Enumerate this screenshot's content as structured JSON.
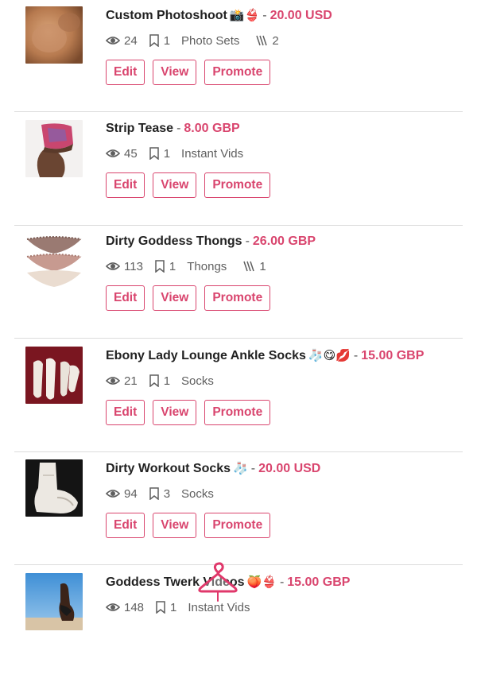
{
  "colors": {
    "accent": "#d9456e",
    "divider": "#dcdcdc",
    "text": "#222222",
    "muted": "#5f5f5f"
  },
  "buttons": {
    "edit": "Edit",
    "view": "View",
    "promote": "Promote"
  },
  "listings": [
    {
      "title": "Custom Photoshoot",
      "emoji": "📸👙",
      "price": "20.00 USD",
      "views": "24",
      "saves": "1",
      "category": "Photo Sets",
      "count": "2",
      "thumb": "skin"
    },
    {
      "title": "Strip Tease",
      "emoji": "",
      "price": "8.00 GBP",
      "views": "45",
      "saves": "1",
      "category": "Instant Vids",
      "count": "",
      "thumb": "strip"
    },
    {
      "title": "Dirty Goddess Thongs",
      "emoji": "",
      "price": "26.00 GBP",
      "views": "113",
      "saves": "1",
      "category": "Thongs",
      "count": "1",
      "thumb": "thongs"
    },
    {
      "title": "Ebony Lady Lounge Ankle Socks",
      "emoji": "🧦😋💋",
      "price": "15.00 GBP",
      "views": "21",
      "saves": "1",
      "category": "Socks",
      "count": "",
      "thumb": "socks"
    },
    {
      "title": "Dirty Workout Socks",
      "emoji": "🧦",
      "price": "20.00 USD",
      "views": "94",
      "saves": "3",
      "category": "Socks",
      "count": "",
      "thumb": "sock"
    },
    {
      "title": "Goddess Twerk Videos",
      "emoji": "🍑👙",
      "price": "15.00 GBP",
      "views": "148",
      "saves": "1",
      "category": "Instant Vids",
      "count": "",
      "thumb": "beach"
    }
  ]
}
